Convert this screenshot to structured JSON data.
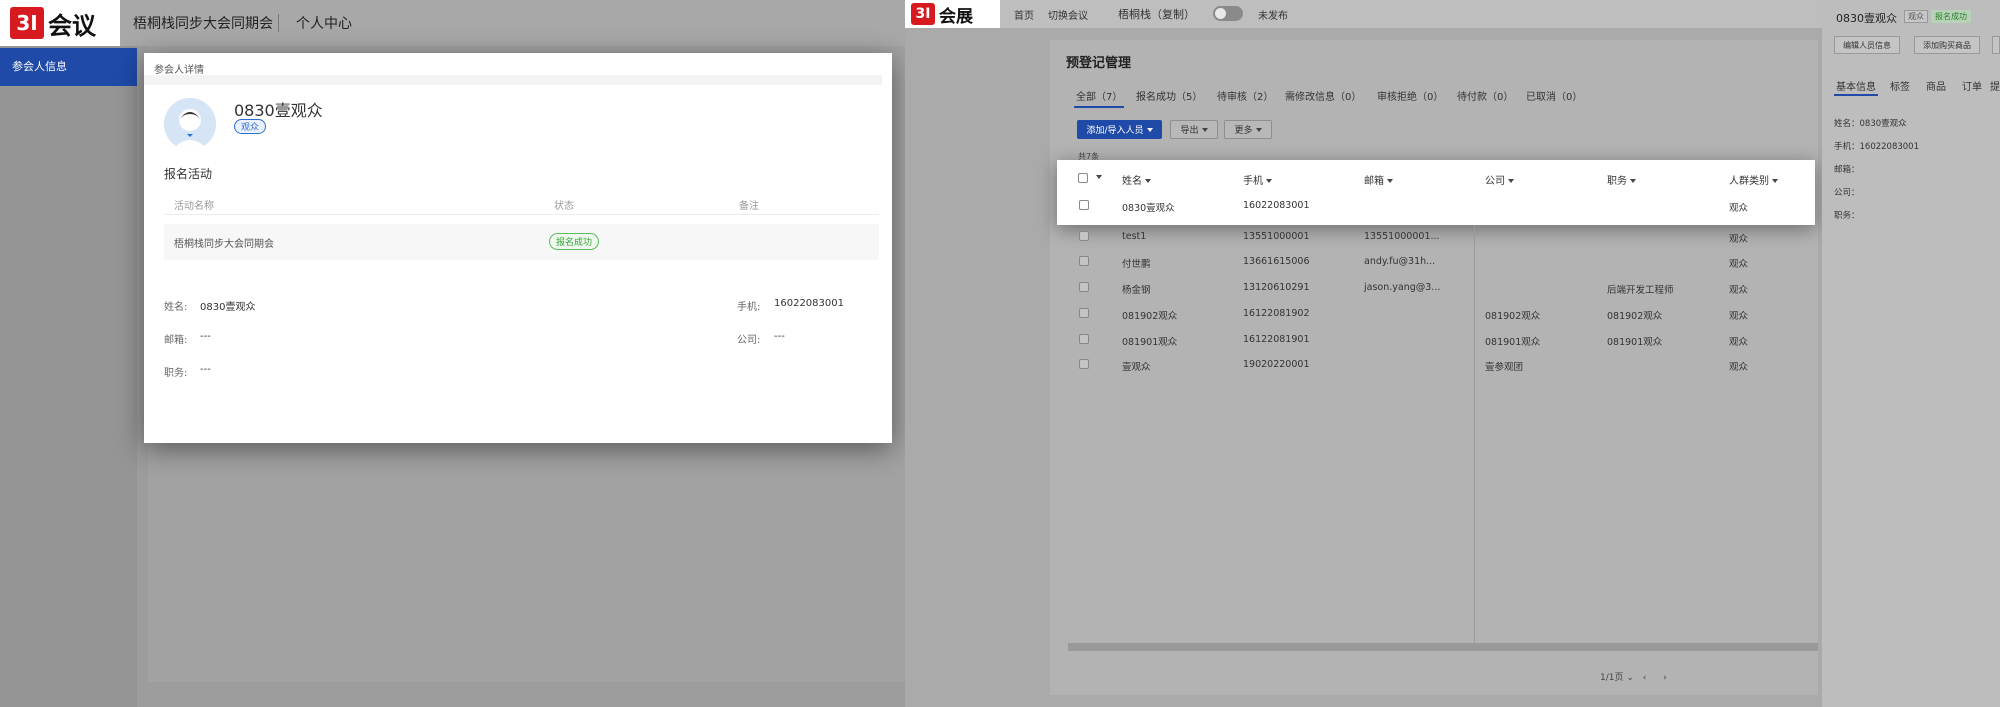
{
  "left": {
    "logo": {
      "mark": "3I",
      "text": "会议"
    },
    "nav": {
      "conference": "梧桐栈同步大会同期会",
      "personal_center": "个人中心"
    },
    "sidebar": {
      "active_item": "参会人信息"
    },
    "modal": {
      "title": "参会人详情",
      "name": "0830壹观众",
      "tag": "观众",
      "section_title": "报名活动",
      "columns": {
        "name": "活动名称",
        "status": "状态",
        "note": "备注"
      },
      "row": {
        "name": "梧桐栈同步大会同期会",
        "status": "报名成功",
        "note": ""
      },
      "info": {
        "name_label": "姓名:",
        "name_value": "0830壹观众",
        "phone_label": "手机:",
        "phone_value": "16022083001",
        "email_label": "邮箱:",
        "email_value": "---",
        "company_label": "公司:",
        "company_value": "---",
        "job_label": "职务:",
        "job_value": "---"
      }
    }
  },
  "right": {
    "logo": {
      "mark": "3I",
      "text": "会展"
    },
    "topbar": {
      "home": "首页",
      "switch": "切换会议",
      "project": "梧桐栈（复制）",
      "publish_status": "未发布"
    },
    "page_title": "预登记管理",
    "tabs": [
      {
        "label": "全部（7）"
      },
      {
        "label": "报名成功（5）"
      },
      {
        "label": "待审核（2）"
      },
      {
        "label": "需修改信息（0）"
      },
      {
        "label": "审核拒绝（0）"
      },
      {
        "label": "待付款（0）"
      },
      {
        "label": "已取消（0）"
      }
    ],
    "buttons": {
      "add": "添加/导入人员",
      "export": "导出",
      "more": "更多"
    },
    "total": "共7条",
    "columns": [
      "姓名",
      "手机",
      "邮箱",
      "公司",
      "职务",
      "人群类别"
    ],
    "rows": [
      {
        "name": "0830壹观众",
        "phone": "16022083001",
        "email": "",
        "company": "",
        "job": "",
        "type": "观众"
      },
      {
        "name": "test1",
        "phone": "13551000001",
        "email": "13551000001...",
        "company": "",
        "job": "",
        "type": "观众"
      },
      {
        "name": "付世鹏",
        "phone": "13661615006",
        "email": "andy.fu@31h...",
        "company": "",
        "job": "",
        "type": "观众"
      },
      {
        "name": "杨金钢",
        "phone": "13120610291",
        "email": "jason.yang@3...",
        "company": "",
        "job": "后端开发工程师",
        "type": "观众"
      },
      {
        "name": "081902观众",
        "phone": "16122081902",
        "email": "",
        "company": "081902观众",
        "job": "081902观众",
        "type": "观众"
      },
      {
        "name": "081901观众",
        "phone": "16122081901",
        "email": "",
        "company": "081901观众",
        "job": "081901观众",
        "type": "观众"
      },
      {
        "name": "壹观众",
        "phone": "19020220001",
        "email": "",
        "company": "壹参观团",
        "job": "",
        "type": "观众"
      }
    ],
    "pager": "1/1页",
    "panel": {
      "name": "0830壹观众",
      "tag": "观众",
      "status": "报名成功",
      "buttons": [
        "编辑人员信息",
        "添加购买商品"
      ],
      "tabs": [
        "基本信息",
        "标签",
        "商品",
        "订单",
        "提"
      ],
      "fields": [
        "姓名：0830壹观众",
        "手机：16022083001",
        "邮箱：",
        "公司：",
        "职务："
      ]
    }
  }
}
